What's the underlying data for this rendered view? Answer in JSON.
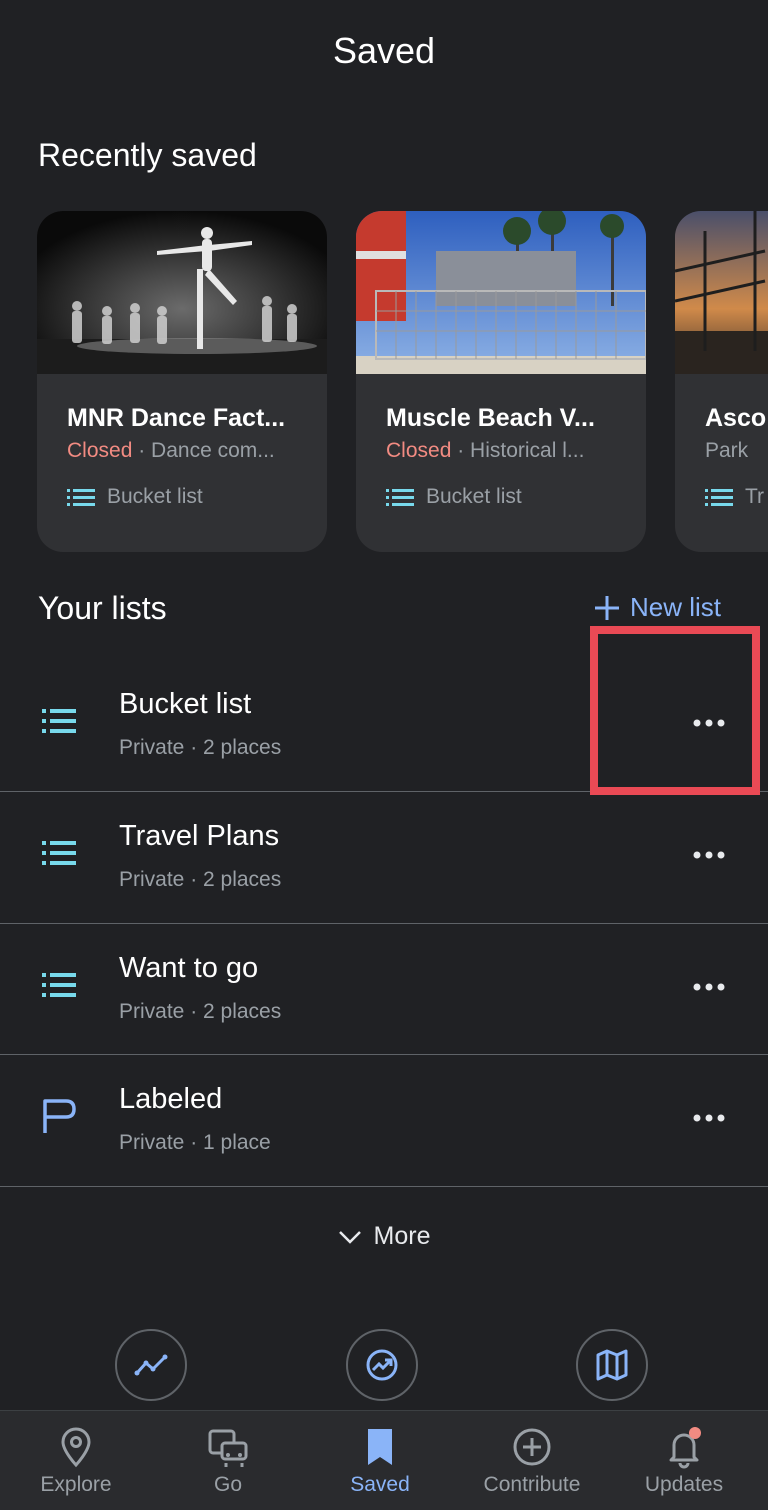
{
  "header": {
    "title": "Saved"
  },
  "recent": {
    "title": "Recently saved",
    "cards": [
      {
        "name": "MNR Dance Fact...",
        "status": "Closed",
        "category": "Dance com...",
        "list": "Bucket list"
      },
      {
        "name": "Muscle Beach V...",
        "status": "Closed",
        "category": "Historical l...",
        "list": "Bucket list"
      },
      {
        "name": "Asco",
        "status": "",
        "category": "Park",
        "list": "Tr"
      }
    ]
  },
  "lists": {
    "title": "Your lists",
    "new_list_label": "New list",
    "items": [
      {
        "name": "Bucket list",
        "meta": "Private · 2 places",
        "icon": "list-icon"
      },
      {
        "name": "Travel Plans",
        "meta": "Private · 2 places",
        "icon": "list-icon"
      },
      {
        "name": "Want to go",
        "meta": "Private · 2 places",
        "icon": "list-icon"
      },
      {
        "name": "Labeled",
        "meta": "Private · 1 place",
        "icon": "label-flag-icon"
      }
    ],
    "more_label": "More"
  },
  "bottom_nav": {
    "items": [
      {
        "label": "Explore",
        "icon": "location-pin-icon"
      },
      {
        "label": "Go",
        "icon": "commute-icon"
      },
      {
        "label": "Saved",
        "icon": "bookmark-icon"
      },
      {
        "label": "Contribute",
        "icon": "add-circle-icon"
      },
      {
        "label": "Updates",
        "icon": "bell-icon"
      }
    ]
  },
  "colors": {
    "background": "#202124",
    "accent": "#8ab4f8",
    "closed": "#f28b82",
    "list_icon": "#78d9ec",
    "highlight": "#ea4a55",
    "notification_dot": "#f28b82"
  }
}
